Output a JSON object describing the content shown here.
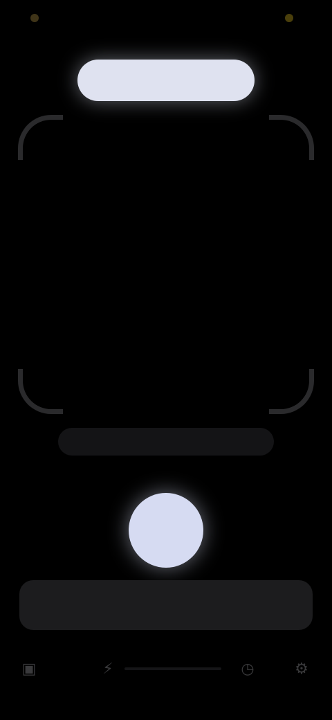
{
  "status_bar": {
    "time": "",
    "left_indicator_color": "#5a4a22",
    "right_indicator_color": "#6a5a10"
  },
  "top_pill": {
    "label": ""
  },
  "scan_frame": {
    "corners": [
      "top-left",
      "top-right",
      "bottom-left",
      "bottom-right"
    ]
  },
  "scan_hint": {
    "text": ""
  },
  "shutter": {
    "icon": "shutter-icon"
  },
  "bottom_banner": {
    "text": ""
  },
  "nav": {
    "icons": [
      "gallery-icon",
      "flash-icon",
      "history-icon",
      "settings-icon"
    ]
  },
  "colors": {
    "background": "#000000",
    "pill": "#dfe2f0",
    "shutter": "#d6dbf2"
  }
}
